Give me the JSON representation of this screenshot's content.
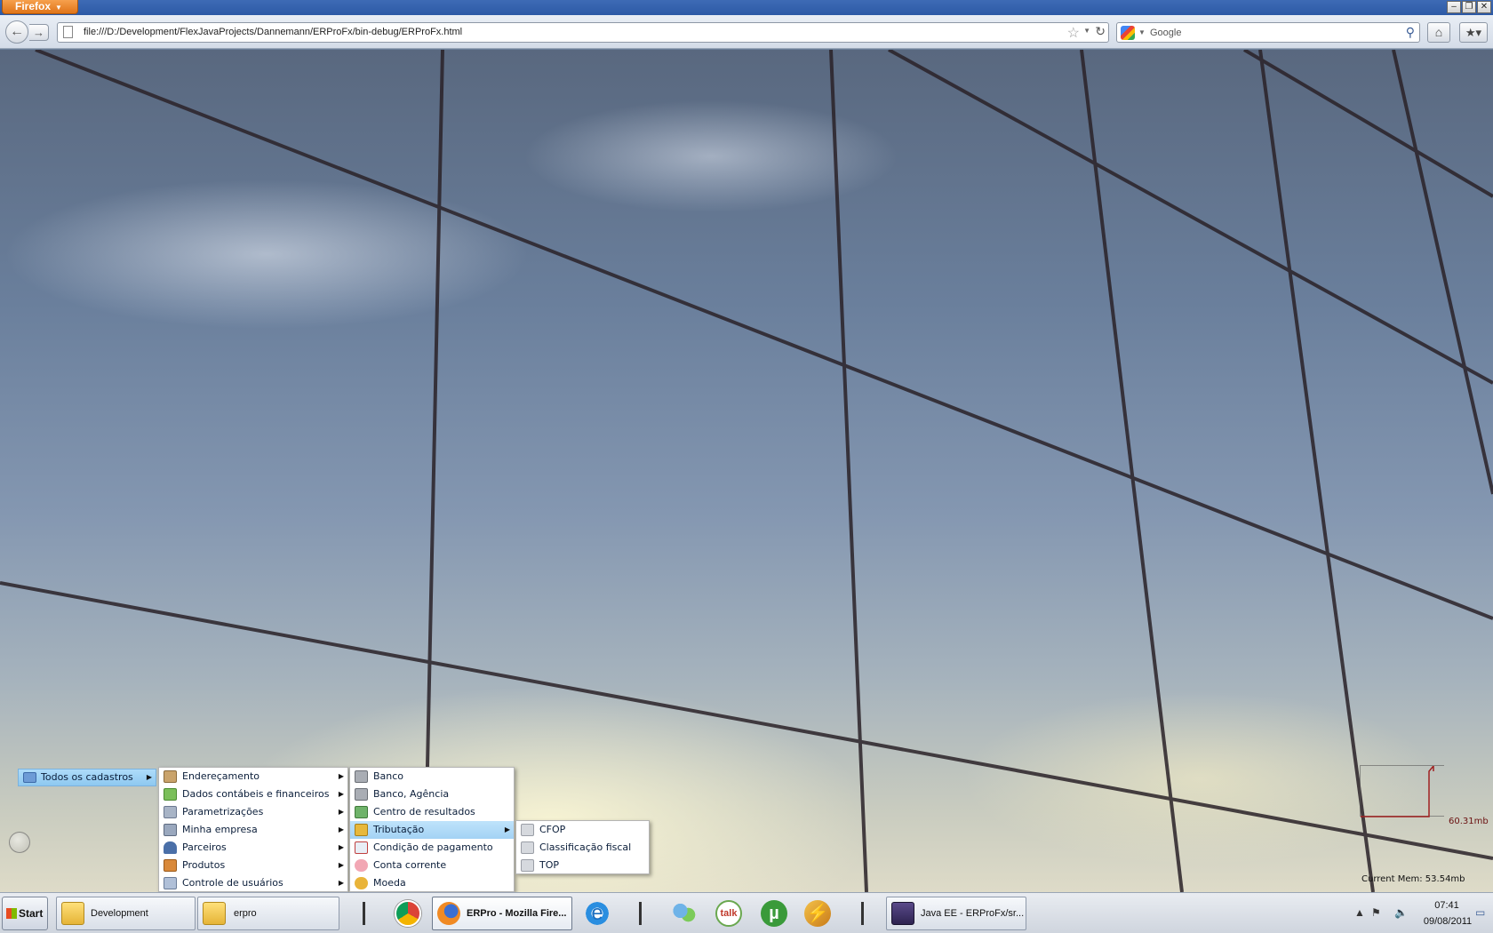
{
  "browser": {
    "app_button": "Firefox",
    "url": "file:///D:/Development/FlexJavaProjects/Dannemann/ERProFx/bin-debug/ERProFx.html",
    "search_placeholder": "Google"
  },
  "menu": {
    "root": {
      "label": "Todos os cadastros"
    },
    "level1": [
      {
        "label": "Endereçamento",
        "icon": "house-icon"
      },
      {
        "label": "Dados contábeis e financeiros",
        "icon": "money-icon"
      },
      {
        "label": "Parametrizações",
        "icon": "settings-icon"
      },
      {
        "label": "Minha empresa",
        "icon": "building-icon"
      },
      {
        "label": "Parceiros",
        "icon": "person-icon"
      },
      {
        "label": "Produtos",
        "icon": "box-icon"
      },
      {
        "label": "Controle de usuários",
        "icon": "users-icon"
      }
    ],
    "level2": [
      {
        "label": "Banco",
        "icon": "bank-icon"
      },
      {
        "label": "Banco, Agência",
        "icon": "bank-icon"
      },
      {
        "label": "Centro de resultados",
        "icon": "org-chart-icon"
      },
      {
        "label": "Tributação",
        "icon": "tax-icon"
      },
      {
        "label": "Condição de pagamento",
        "icon": "calendar-icon"
      },
      {
        "label": "Conta corrente",
        "icon": "piggy-bank-icon"
      },
      {
        "label": "Moeda",
        "icon": "euro-coin-icon"
      }
    ],
    "level3": [
      {
        "label": "CFOP",
        "icon": "cube-icon"
      },
      {
        "label": "Classificação fiscal",
        "icon": "cube-icon"
      },
      {
        "label": "TOP",
        "icon": "cube-icon"
      }
    ]
  },
  "memory": {
    "peak": "60.31mb",
    "current": "Current Mem: 53.54mb"
  },
  "taskbar": {
    "start": "Start",
    "tasks": [
      {
        "label": "Development"
      },
      {
        "label": "erpro"
      },
      {
        "label": "ERPro - Mozilla Fire..."
      },
      {
        "label": "Java EE - ERProFx/sr..."
      }
    ],
    "clock_time": "07:41",
    "clock_date": "09/08/2011"
  },
  "colors": {
    "menu_highlight": "#a3d2f4",
    "firefox_orange": "#e07418",
    "memory_line": "#a02020"
  }
}
